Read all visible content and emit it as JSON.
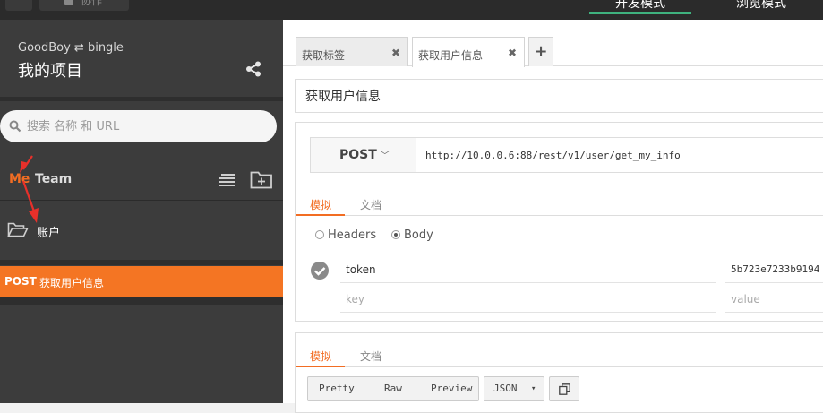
{
  "topbar": {
    "collab_label": "协作",
    "mode_dev": "开发模式",
    "mode_browse": "浏览模式"
  },
  "sidebar": {
    "project_sub": "GoodBoy ⇄ bingle",
    "project_title": "我的项目",
    "search_placeholder": "搜索 名称 和 URL",
    "team_me": "Me",
    "team_team": "Team",
    "folder_label": "账户",
    "active_api": {
      "method": "POST",
      "name": "获取用户信息"
    }
  },
  "main": {
    "tabs": [
      {
        "label": "获取标签",
        "close": "✖"
      },
      {
        "label": "获取用户信息",
        "close": "✖"
      }
    ],
    "add_tab": "+",
    "api_name": "获取用户信息",
    "method": "POST",
    "url": "http://10.0.0.6:88/rest/v1/user/get_my_info",
    "request_tabs": {
      "mock": "模拟",
      "docs": "文档"
    },
    "body_options": {
      "headers": "Headers",
      "body": "Body",
      "selected": "Body"
    },
    "params": [
      {
        "key": "token",
        "value": "5b723e7233b9194"
      },
      {
        "key": "",
        "value": "",
        "key_placeholder": "key",
        "value_placeholder": "value"
      }
    ],
    "response_tabs": {
      "mock": "模拟",
      "docs": "文档"
    },
    "format_buttons": [
      "Pretty",
      "Raw",
      "Preview"
    ],
    "format_select": "JSON"
  },
  "colors": {
    "accent": "#f26d23",
    "sidebar_bg": "#3c3c3c",
    "active_mode": "#3fb27f"
  }
}
